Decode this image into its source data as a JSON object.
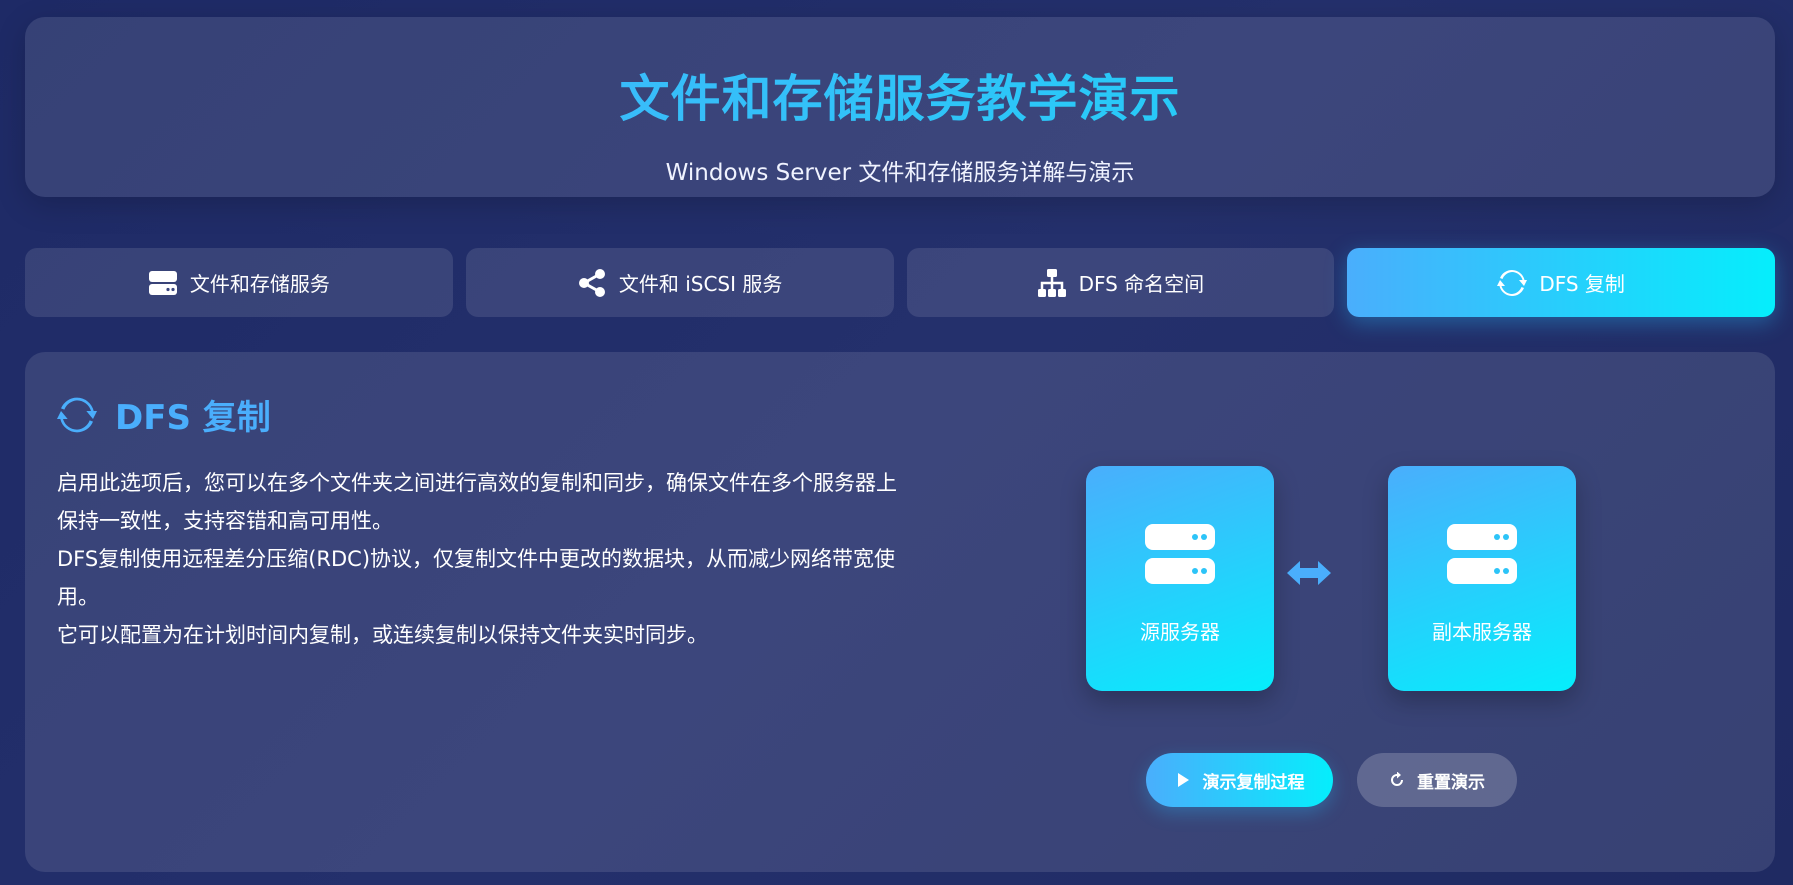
{
  "header": {
    "title": "文件和存储服务教学演示",
    "subtitle": "Windows Server 文件和存储服务详解与演示"
  },
  "tabs": [
    {
      "label": "文件和存储服务",
      "icon": "hdd-icon",
      "active": false
    },
    {
      "label": "文件和 iSCSI 服务",
      "icon": "share-icon",
      "active": false
    },
    {
      "label": "DFS 命名空间",
      "icon": "sitemap-icon",
      "active": false
    },
    {
      "label": "DFS 复制",
      "icon": "sync-icon",
      "active": true
    }
  ],
  "section": {
    "icon": "sync-icon",
    "title": "DFS 复制",
    "paragraphs": [
      "启用此选项后，您可以在多个文件夹之间进行高效的复制和同步，确保文件在多个服务器上保持一致性，支持容错和高可用性。",
      "DFS复制使用远程差分压缩(RDC)协议，仅复制文件中更改的数据块，从而减少网络带宽使用。",
      "它可以配置为在计划时间内复制，或连续复制以保持文件夹实时同步。"
    ]
  },
  "demo": {
    "source_label": "源服务器",
    "replica_label": "副本服务器",
    "server_icon": "server-icon",
    "arrow_icon": "arrows-h-icon",
    "play_label": "演示复制过程",
    "reset_label": "重置演示"
  },
  "colors": {
    "accent_start": "#4aaefc",
    "accent_end": "#05eefc",
    "background": "#1e2a66"
  }
}
